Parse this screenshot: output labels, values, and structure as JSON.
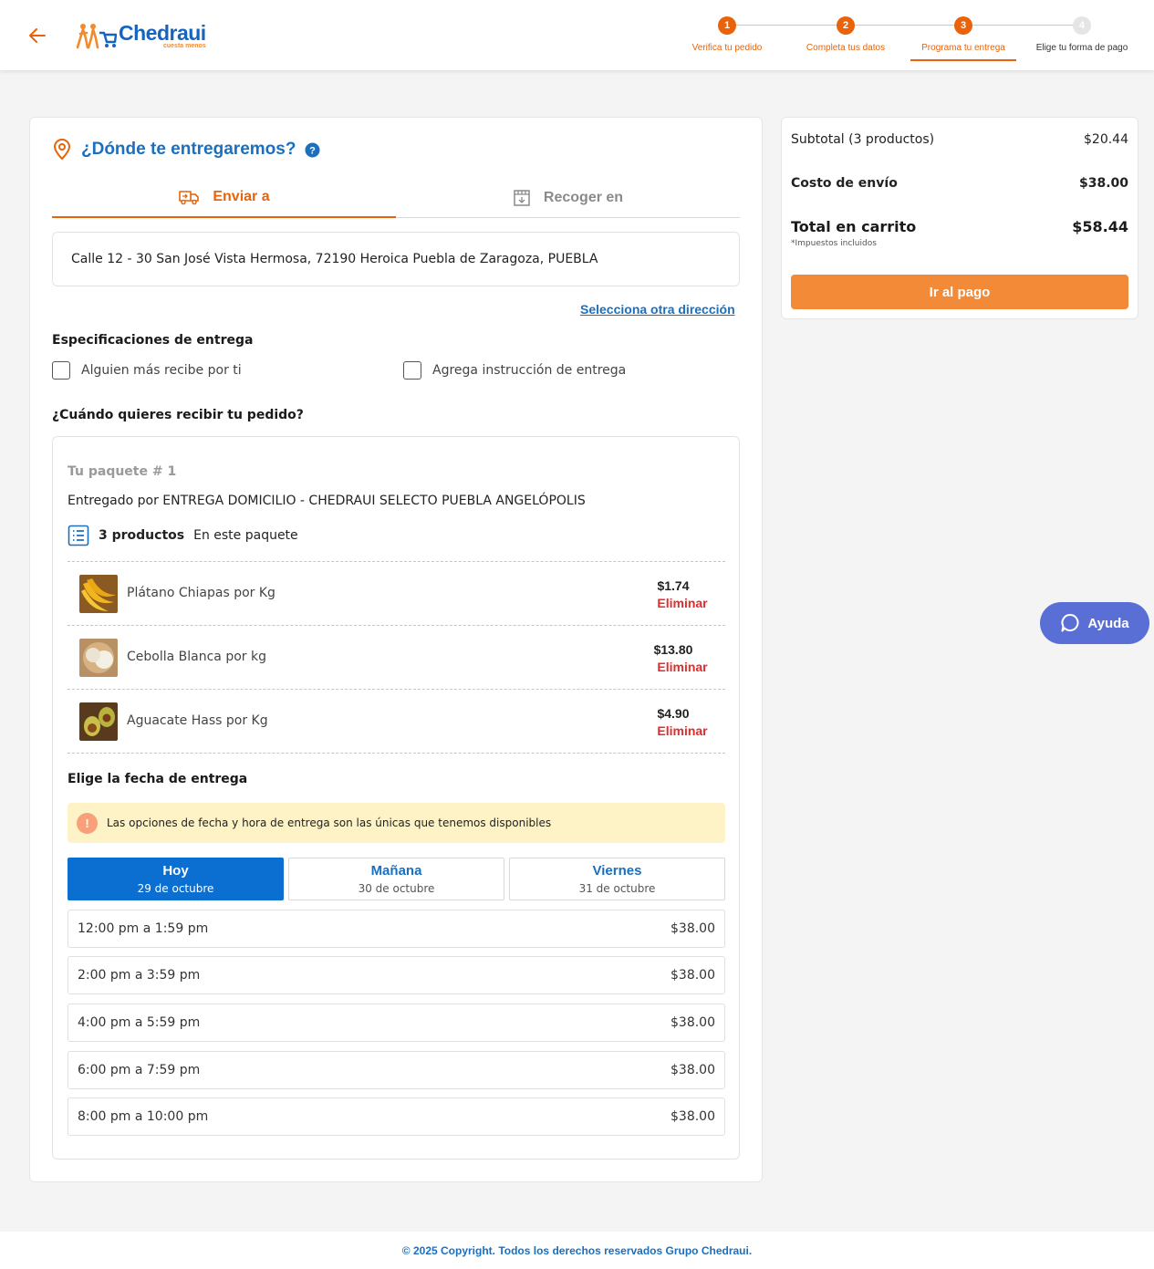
{
  "header": {
    "logo_name": "Chedraui",
    "logo_tagline": "cuesta menos",
    "steps": [
      {
        "number": "1",
        "label": "Verifica tu pedido",
        "state": "done"
      },
      {
        "number": "2",
        "label": "Completa tus datos",
        "state": "done"
      },
      {
        "number": "3",
        "label": "Programa tu entrega",
        "state": "current"
      },
      {
        "number": "4",
        "label": "Elige tu forma de pago",
        "state": "pending"
      }
    ]
  },
  "delivery": {
    "title": "¿Dónde te entregaremos?",
    "tabs": [
      {
        "label": "Enviar a",
        "active": true
      },
      {
        "label": "Recoger en",
        "active": false
      }
    ],
    "address": "Calle 12 - 30 San José Vista Hermosa, 72190 Heroica Puebla de Zaragoza, PUEBLA",
    "other_address_link": "Selecciona otra dirección",
    "specs_title": "Especificaciones de entrega",
    "options": [
      {
        "label": "Alguien más recibe por ti",
        "checked": false
      },
      {
        "label": "Agrega instrucción de entrega",
        "checked": false
      }
    ],
    "when_title": "¿Cuándo quieres recibir tu pedido?"
  },
  "package": {
    "title": "Tu paquete # 1",
    "delivered_by": "Entregado por ENTREGA DOMICILIO - CHEDRAUI SELECTO PUEBLA ANGELÓPOLIS",
    "count_bold": "3 productos",
    "count_rest": "En este paquete",
    "products": [
      {
        "name": "Plátano Chiapas por Kg",
        "price": "$1.74",
        "remove": "Eliminar"
      },
      {
        "name": "Cebolla Blanca por kg",
        "price": "$13.80",
        "remove": "Eliminar"
      },
      {
        "name": "Aguacate Hass por Kg",
        "price": "$4.90",
        "remove": "Eliminar"
      }
    ],
    "date_title": "Elige la fecha de entrega",
    "notice": "Las opciones de fecha y hora de entrega son las únicas que tenemos disponibles",
    "days": [
      {
        "label": "Hoy",
        "date": "29 de octubre",
        "active": true
      },
      {
        "label": "Mañana",
        "date": "30 de octubre",
        "active": false
      },
      {
        "label": "Viernes",
        "date": "31 de octubre",
        "active": false
      }
    ],
    "slots": [
      {
        "time": "12:00 pm a 1:59 pm",
        "price": "$38.00"
      },
      {
        "time": "2:00 pm a 3:59 pm",
        "price": "$38.00"
      },
      {
        "time": "4:00 pm a 5:59 pm",
        "price": "$38.00"
      },
      {
        "time": "6:00 pm a 7:59 pm",
        "price": "$38.00"
      },
      {
        "time": "8:00 pm a 10:00 pm",
        "price": "$38.00"
      }
    ]
  },
  "summary": {
    "subtotal_label": "Subtotal (3 productos)",
    "subtotal_value": "$20.44",
    "shipping_label": "Costo de envío",
    "shipping_value": "$38.00",
    "total_label": "Total en carrito",
    "total_value": "$58.44",
    "tax_note": "*Impuestos incluidos",
    "pay_button": "Ir al pago"
  },
  "help_button": "Ayuda",
  "footer": "© 2025 Copyright. Todos los derechos reservados Grupo Chedraui.",
  "colors": {
    "brand_blue": "#1a6fbf",
    "brand_orange": "#e8630a",
    "pay_orange": "#f28a37",
    "remove_red": "#e32b2b",
    "help_purple": "#5a6fd6"
  }
}
